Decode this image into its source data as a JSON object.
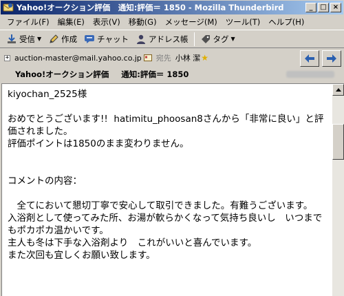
{
  "window": {
    "title": "Yahoo!オークション評価　通知:評価＝ 1850 - Mozilla Thunderbird",
    "controls": [
      "_",
      "□",
      "×"
    ]
  },
  "menu": [
    "ファイル(F)",
    "編集(E)",
    "表示(V)",
    "移動(G)",
    "メッセージ(M)",
    "ツール(T)",
    "ヘルプ(H)"
  ],
  "toolbar": {
    "receive": "受信",
    "compose": "作成",
    "chat": "チャット",
    "address_book": "アドレス帳",
    "tag": "タグ"
  },
  "header": {
    "from": "auction-master@mail.yahoo.co.jp",
    "to_label": "宛先",
    "to_name": "小林 潔",
    "subject_part1": "Yahoo!オークション評価",
    "subject_part2": "通知:評価＝ 1850"
  },
  "message": {
    "body": "kiyochan_2525様\n\nおめでとうございます!!  hatimitu_phoosan8さんから「非常に良い」と評価されました。\n評価ポイントは1850のまま変わりません。\n\n\nコメントの内容：\n\n　全てにおいて懇切丁寧で安心して取引できました。有難うございます。\n入浴剤として使ってみた所、お湯が軟らかくなって気持ち良いし　いつまでもポカポカ温かいです。\n主人も冬は下手な入浴剤より　これがいいと喜んでいます。\nまた次回も宜しくお願い致します。"
  },
  "icons": {
    "app": "thunderbird-icon",
    "receive": "receive-mail-icon",
    "compose": "pencil-icon",
    "chat": "chat-icon",
    "address_book": "contact-icon",
    "tag": "tag-icon",
    "reply": "reply-icon",
    "forward": "forward-icon"
  }
}
